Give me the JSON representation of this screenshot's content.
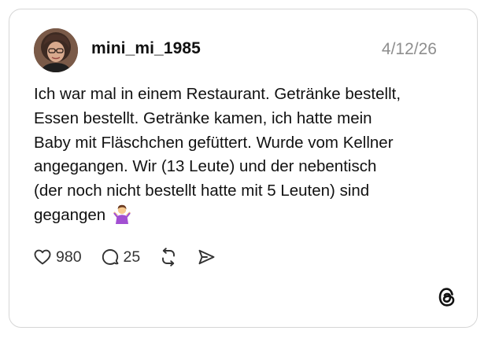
{
  "post": {
    "username": "mini_mi_1985",
    "date": "4/12/26",
    "text": "Ich war mal in einem Restaurant. Getränke bestellt,\nEssen bestellt. Getränke kamen, ich hatte mein\nBaby mit Fläschchen gefüttert. Wurde vom Kellner\nangegangen. Wir (13 Leute) und der nebentisch\n(der noch nicht bestellt hatte mit 5 Leuten) sind\ngegangen",
    "emoji": "person-shrugging-emoji"
  },
  "actions": {
    "likes": "980",
    "replies": "25"
  },
  "icons": {
    "avatar": "profile-photo",
    "like": "heart-icon",
    "reply": "speech-bubble-icon",
    "repost": "repost-icon",
    "share": "send-icon",
    "brand": "threads-logo"
  },
  "colors": {
    "text": "#111111",
    "muted": "#8e8e8e",
    "border": "#d6d6d6"
  }
}
